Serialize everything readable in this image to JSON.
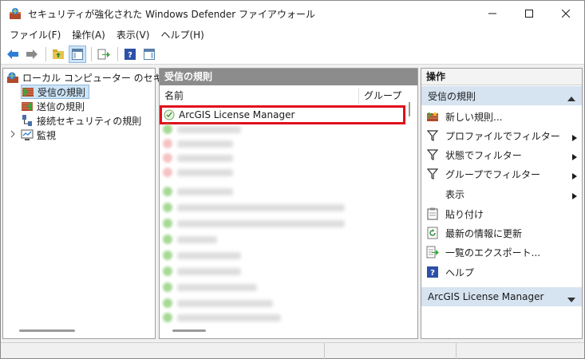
{
  "window": {
    "title": "セキュリティが強化された Windows Defender ファイアウォール"
  },
  "menu": [
    "ファイル(F)",
    "操作(A)",
    "表示(V)",
    "ヘルプ(H)"
  ],
  "tree": {
    "root": "ローカル コンピューター のセキュリティ",
    "items": [
      "受信の規則",
      "送信の規則",
      "接続セキュリティの規則",
      "監視"
    ]
  },
  "center": {
    "header": "受信の規則",
    "columns": {
      "name": "名前",
      "group": "グループ"
    },
    "rows": [
      "ArcGIS License Manager"
    ]
  },
  "actions": {
    "header": "操作",
    "section1": "受信の規則",
    "items": [
      "新しい規則...",
      "プロファイルでフィルター",
      "状態でフィルター",
      "グループでフィルター",
      "表示",
      "貼り付け",
      "最新の情報に更新",
      "一覧のエクスポート...",
      "ヘルプ"
    ],
    "section2": "ArcGIS License Manager"
  },
  "colors": {
    "highlight": "#e0101a",
    "section_bg": "#d6e3f0",
    "header_bg": "#8c8c8c"
  }
}
